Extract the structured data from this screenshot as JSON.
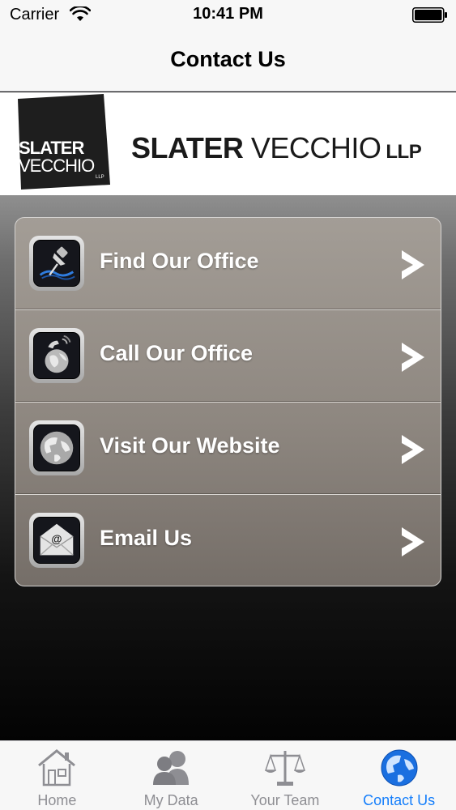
{
  "status_bar": {
    "carrier": "Carrier",
    "time": "10:41 PM"
  },
  "nav": {
    "title": "Contact Us"
  },
  "logo": {
    "word1": "SLATER",
    "word2": "VECCHIO",
    "suffix": "LLP",
    "mark_line1": "SLATER",
    "mark_line2": "VECCHIO",
    "mark_line3": "LLP"
  },
  "menu": {
    "items": [
      {
        "label": "Find Our Office",
        "icon": "map-pin-icon"
      },
      {
        "label": "Call Our Office",
        "icon": "phone-globe-icon"
      },
      {
        "label": "Visit Our Website",
        "icon": "globe-icon"
      },
      {
        "label": "Email Us",
        "icon": "envelope-icon"
      }
    ]
  },
  "tabs": [
    {
      "label": "Home",
      "icon": "house-icon",
      "active": false
    },
    {
      "label": "My Data",
      "icon": "people-icon",
      "active": false
    },
    {
      "label": "Your Team",
      "icon": "scales-icon",
      "active": false
    },
    {
      "label": "Contact Us",
      "icon": "globe-icon",
      "active": true
    }
  ],
  "colors": {
    "accent": "#147efb",
    "inactive": "#8e8e93"
  }
}
